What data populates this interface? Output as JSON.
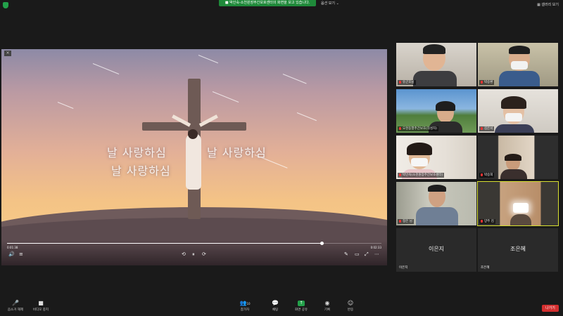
{
  "topbar": {
    "banner": "■ 박인숙-소천원장주간보호센터의 화면을 보고 있습니다.",
    "view_option": "옵션 보기 ⌄",
    "layout_button": "▦ 갤러리 보기"
  },
  "share": {
    "close_glyph": "×",
    "lyrics_line1_a": "날 사랑하심",
    "lyrics_line1_b": "날 사랑하심",
    "lyrics_line2": "날 사랑하심",
    "time_elapsed": "0:01:38",
    "time_total": "0:02:33",
    "progress": 0.84,
    "controls": {
      "volume_glyph": "🔊",
      "subtitles_glyph": "≡",
      "rewind_glyph": "⟲",
      "pause_glyph": "⏸",
      "forward_glyph": "⟳",
      "edit_glyph": "✎",
      "pip_glyph": "▭",
      "fullscreen_glyph": "⤢",
      "more_glyph": "⋯"
    }
  },
  "participants": [
    {
      "name": "유곤호님"
    },
    {
      "name": "박승환"
    },
    {
      "name": "오천동열주간보호(작성자)"
    },
    {
      "name": "김은서"
    },
    {
      "name": "박인숙(소천원장주간보호센터)"
    },
    {
      "name": "박승희"
    },
    {
      "name": "정은 님"
    },
    {
      "name": "양주 김"
    },
    {
      "name": "이은지",
      "big": "이은지"
    },
    {
      "name": "조은혜",
      "big": "조은혜"
    }
  ],
  "bottombar": {
    "mute": "음소거 해제",
    "video": "비디오 중지",
    "participants": "참가자",
    "participants_count": "10",
    "chat": "채팅",
    "share_screen": "화면 공유",
    "record": "기록",
    "reactions": "반응",
    "leave": "나가기"
  },
  "colors": {
    "banner_green": "#1f8a3a",
    "active_speaker": "#d8e030",
    "leave_red": "#d32f2f"
  }
}
